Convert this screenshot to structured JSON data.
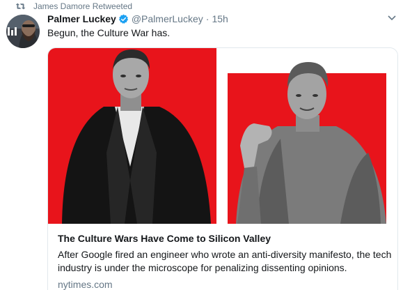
{
  "retweet_context": {
    "text": "James Damore Retweeted",
    "icon": "retweet-icon"
  },
  "tweet": {
    "display_name": "Palmer Luckey",
    "verified": true,
    "handle": "@PalmerLuckey",
    "separator": "·",
    "time": "15h",
    "text": "Begun, the Culture War has."
  },
  "card": {
    "title": "The Culture Wars Have Come to Silicon Valley",
    "description": "After Google fired an engineer who wrote an anti-diversity manifesto, the tech industry is under the microscope for penalizing dissenting opinions.",
    "domain": "nytimes.com"
  },
  "colors": {
    "accent": "#1da1f2",
    "muted_text": "#657786",
    "primary_text": "#14171a",
    "border": "#e1e8ed",
    "card_red": "#e8141b"
  }
}
